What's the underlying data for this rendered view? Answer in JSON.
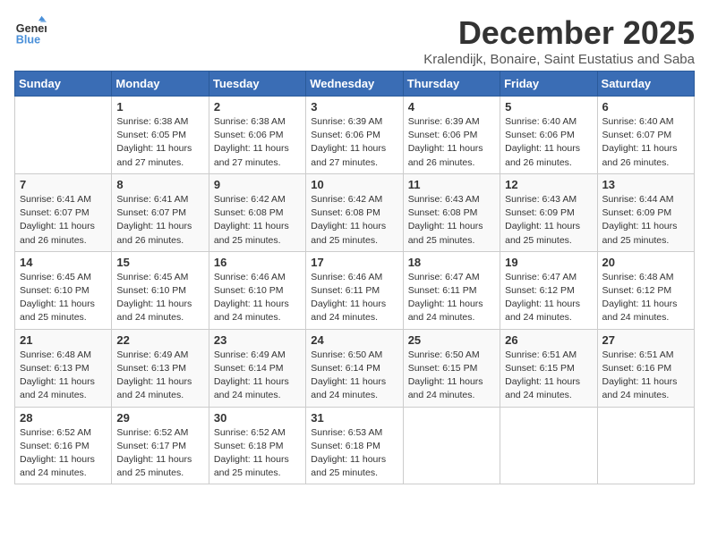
{
  "header": {
    "logo_line1": "General",
    "logo_line2": "Blue",
    "month": "December 2025",
    "location": "Kralendijk, Bonaire, Saint Eustatius and Saba"
  },
  "days_of_week": [
    "Sunday",
    "Monday",
    "Tuesday",
    "Wednesday",
    "Thursday",
    "Friday",
    "Saturday"
  ],
  "weeks": [
    [
      {
        "day": "",
        "info": ""
      },
      {
        "day": "1",
        "info": "Sunrise: 6:38 AM\nSunset: 6:05 PM\nDaylight: 11 hours and 27 minutes."
      },
      {
        "day": "2",
        "info": "Sunrise: 6:38 AM\nSunset: 6:06 PM\nDaylight: 11 hours and 27 minutes."
      },
      {
        "day": "3",
        "info": "Sunrise: 6:39 AM\nSunset: 6:06 PM\nDaylight: 11 hours and 27 minutes."
      },
      {
        "day": "4",
        "info": "Sunrise: 6:39 AM\nSunset: 6:06 PM\nDaylight: 11 hours and 26 minutes."
      },
      {
        "day": "5",
        "info": "Sunrise: 6:40 AM\nSunset: 6:06 PM\nDaylight: 11 hours and 26 minutes."
      },
      {
        "day": "6",
        "info": "Sunrise: 6:40 AM\nSunset: 6:07 PM\nDaylight: 11 hours and 26 minutes."
      }
    ],
    [
      {
        "day": "7",
        "info": "Sunrise: 6:41 AM\nSunset: 6:07 PM\nDaylight: 11 hours and 26 minutes."
      },
      {
        "day": "8",
        "info": "Sunrise: 6:41 AM\nSunset: 6:07 PM\nDaylight: 11 hours and 26 minutes."
      },
      {
        "day": "9",
        "info": "Sunrise: 6:42 AM\nSunset: 6:08 PM\nDaylight: 11 hours and 25 minutes."
      },
      {
        "day": "10",
        "info": "Sunrise: 6:42 AM\nSunset: 6:08 PM\nDaylight: 11 hours and 25 minutes."
      },
      {
        "day": "11",
        "info": "Sunrise: 6:43 AM\nSunset: 6:08 PM\nDaylight: 11 hours and 25 minutes."
      },
      {
        "day": "12",
        "info": "Sunrise: 6:43 AM\nSunset: 6:09 PM\nDaylight: 11 hours and 25 minutes."
      },
      {
        "day": "13",
        "info": "Sunrise: 6:44 AM\nSunset: 6:09 PM\nDaylight: 11 hours and 25 minutes."
      }
    ],
    [
      {
        "day": "14",
        "info": "Sunrise: 6:45 AM\nSunset: 6:10 PM\nDaylight: 11 hours and 25 minutes."
      },
      {
        "day": "15",
        "info": "Sunrise: 6:45 AM\nSunset: 6:10 PM\nDaylight: 11 hours and 24 minutes."
      },
      {
        "day": "16",
        "info": "Sunrise: 6:46 AM\nSunset: 6:10 PM\nDaylight: 11 hours and 24 minutes."
      },
      {
        "day": "17",
        "info": "Sunrise: 6:46 AM\nSunset: 6:11 PM\nDaylight: 11 hours and 24 minutes."
      },
      {
        "day": "18",
        "info": "Sunrise: 6:47 AM\nSunset: 6:11 PM\nDaylight: 11 hours and 24 minutes."
      },
      {
        "day": "19",
        "info": "Sunrise: 6:47 AM\nSunset: 6:12 PM\nDaylight: 11 hours and 24 minutes."
      },
      {
        "day": "20",
        "info": "Sunrise: 6:48 AM\nSunset: 6:12 PM\nDaylight: 11 hours and 24 minutes."
      }
    ],
    [
      {
        "day": "21",
        "info": "Sunrise: 6:48 AM\nSunset: 6:13 PM\nDaylight: 11 hours and 24 minutes."
      },
      {
        "day": "22",
        "info": "Sunrise: 6:49 AM\nSunset: 6:13 PM\nDaylight: 11 hours and 24 minutes."
      },
      {
        "day": "23",
        "info": "Sunrise: 6:49 AM\nSunset: 6:14 PM\nDaylight: 11 hours and 24 minutes."
      },
      {
        "day": "24",
        "info": "Sunrise: 6:50 AM\nSunset: 6:14 PM\nDaylight: 11 hours and 24 minutes."
      },
      {
        "day": "25",
        "info": "Sunrise: 6:50 AM\nSunset: 6:15 PM\nDaylight: 11 hours and 24 minutes."
      },
      {
        "day": "26",
        "info": "Sunrise: 6:51 AM\nSunset: 6:15 PM\nDaylight: 11 hours and 24 minutes."
      },
      {
        "day": "27",
        "info": "Sunrise: 6:51 AM\nSunset: 6:16 PM\nDaylight: 11 hours and 24 minutes."
      }
    ],
    [
      {
        "day": "28",
        "info": "Sunrise: 6:52 AM\nSunset: 6:16 PM\nDaylight: 11 hours and 24 minutes."
      },
      {
        "day": "29",
        "info": "Sunrise: 6:52 AM\nSunset: 6:17 PM\nDaylight: 11 hours and 25 minutes."
      },
      {
        "day": "30",
        "info": "Sunrise: 6:52 AM\nSunset: 6:18 PM\nDaylight: 11 hours and 25 minutes."
      },
      {
        "day": "31",
        "info": "Sunrise: 6:53 AM\nSunset: 6:18 PM\nDaylight: 11 hours and 25 minutes."
      },
      {
        "day": "",
        "info": ""
      },
      {
        "day": "",
        "info": ""
      },
      {
        "day": "",
        "info": ""
      }
    ]
  ]
}
